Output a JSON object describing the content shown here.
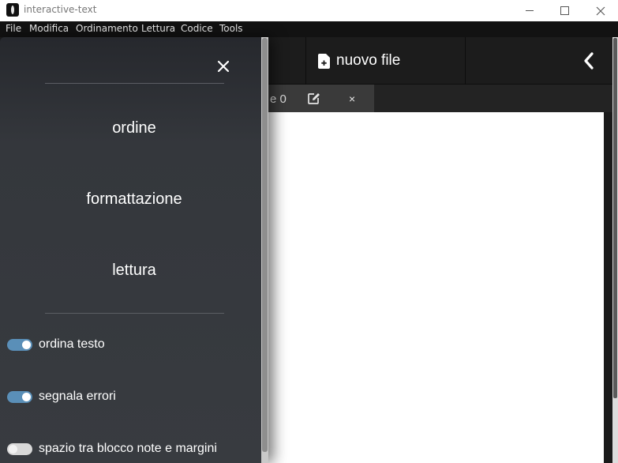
{
  "window": {
    "title": "interactive-text"
  },
  "menu": [
    "File",
    "Modifica",
    "Ordinamento",
    "Lettura",
    "Codice",
    "Tools"
  ],
  "toolbar": {
    "new_file_label": "nuovo file"
  },
  "tab": {
    "label": "e 0",
    "close_glyph": "×"
  },
  "panel": {
    "sections": [
      "ordine",
      "formattazione",
      "lettura"
    ],
    "toggles": [
      {
        "label": "ordina testo",
        "checked": true
      },
      {
        "label": "segnala errori",
        "checked": true
      },
      {
        "label": "spazio tra blocco note e margini",
        "checked": false
      }
    ]
  },
  "colors": {
    "accent_toggle": "#5a8fb8",
    "panel_bg": "#383b40",
    "toolbar_bg": "#1c1c1c",
    "editor_bg": "#ffffff"
  },
  "icons": {
    "app": "app-logo-icon",
    "new_file": "file-plus-icon",
    "back": "chevron-left-icon",
    "edit": "edit-icon",
    "close": "close-icon"
  }
}
